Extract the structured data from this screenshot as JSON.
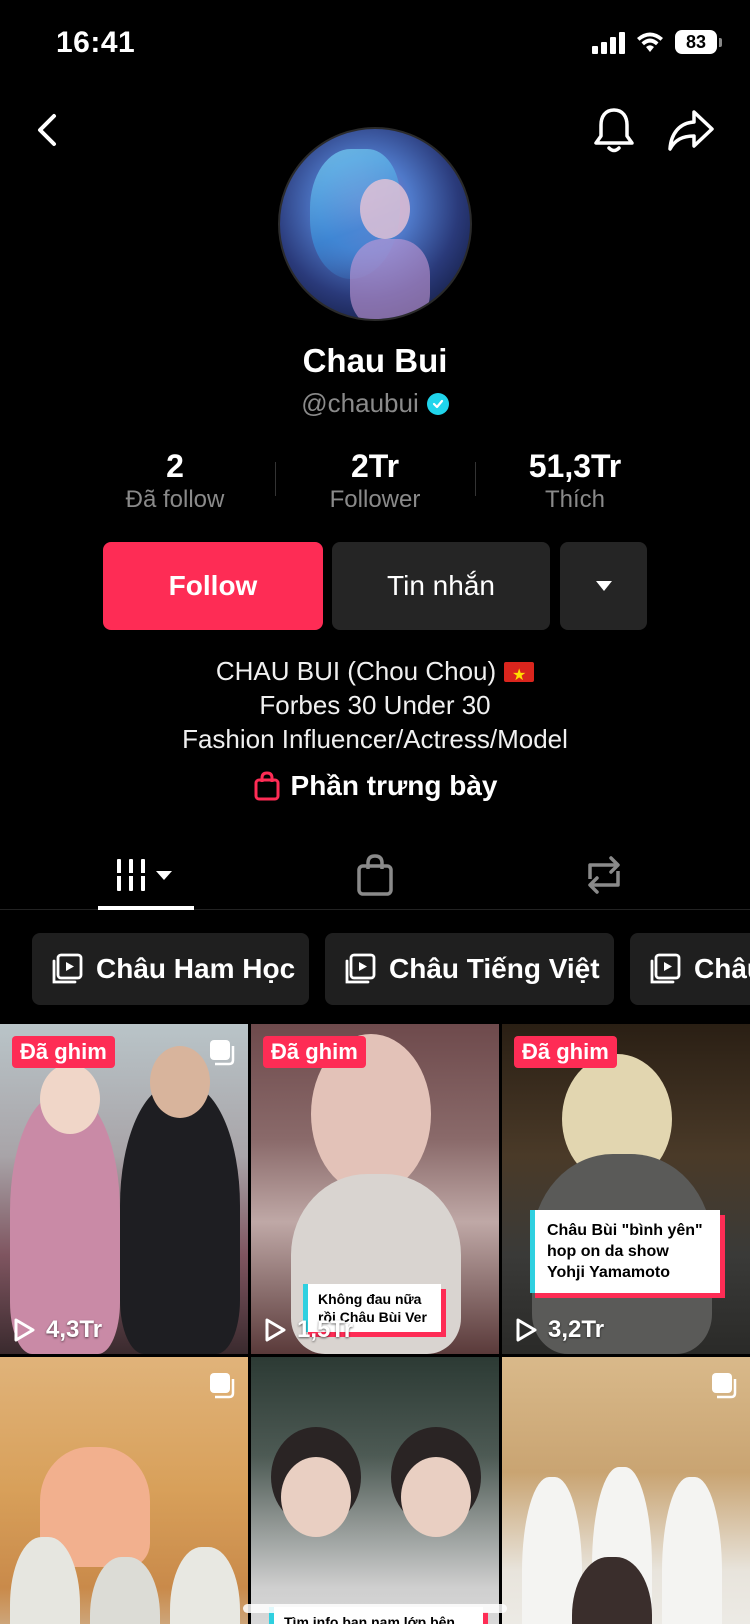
{
  "status_bar": {
    "time": "16:41",
    "battery": "83"
  },
  "profile": {
    "display_name": "Chau Bui",
    "username": "@chaubui",
    "verified": true
  },
  "stats": [
    {
      "value": "2",
      "label": "Đã follow"
    },
    {
      "value": "2Tr",
      "label": "Follower"
    },
    {
      "value": "51,3Tr",
      "label": "Thích"
    }
  ],
  "actions": {
    "follow_label": "Follow",
    "message_label": "Tin nhắn"
  },
  "bio": {
    "line1": "CHAU BUI (Chou Chou)",
    "line2": "Forbes 30 Under 30",
    "line3": "Fashion Influencer/Actress/Model"
  },
  "showcase_label": "Phần trưng bày",
  "tabs": [
    {
      "icon": "videos-grid-icon",
      "active": true
    },
    {
      "icon": "shopping-bag-icon",
      "active": false
    },
    {
      "icon": "repost-icon",
      "active": false
    }
  ],
  "playlists": [
    {
      "label": "Châu Ham Học"
    },
    {
      "label": "Châu Tiếng Việt"
    },
    {
      "label": "Châu"
    }
  ],
  "videos": [
    {
      "pinned_label": "Đã ghim",
      "views": "4,3Tr",
      "caption": ""
    },
    {
      "pinned_label": "Đã ghim",
      "views": "1,5Tr",
      "caption": "Không đau nữa rồi Châu Bùi Ver"
    },
    {
      "pinned_label": "Đã ghim",
      "views": "3,2Tr",
      "caption": "Châu Bùi \"bình yên\" hop on da show Yohji Yamamoto"
    },
    {
      "pinned_label": "",
      "views": "",
      "caption": ""
    },
    {
      "pinned_label": "",
      "views": "",
      "caption": "Tìm info bạn nam lớp bên"
    },
    {
      "pinned_label": "",
      "views": "",
      "caption": ""
    }
  ],
  "colors": {
    "accent": "#fe2c55",
    "verified": "#20d5ec",
    "button_dark": "#252525",
    "background": "#000000"
  }
}
